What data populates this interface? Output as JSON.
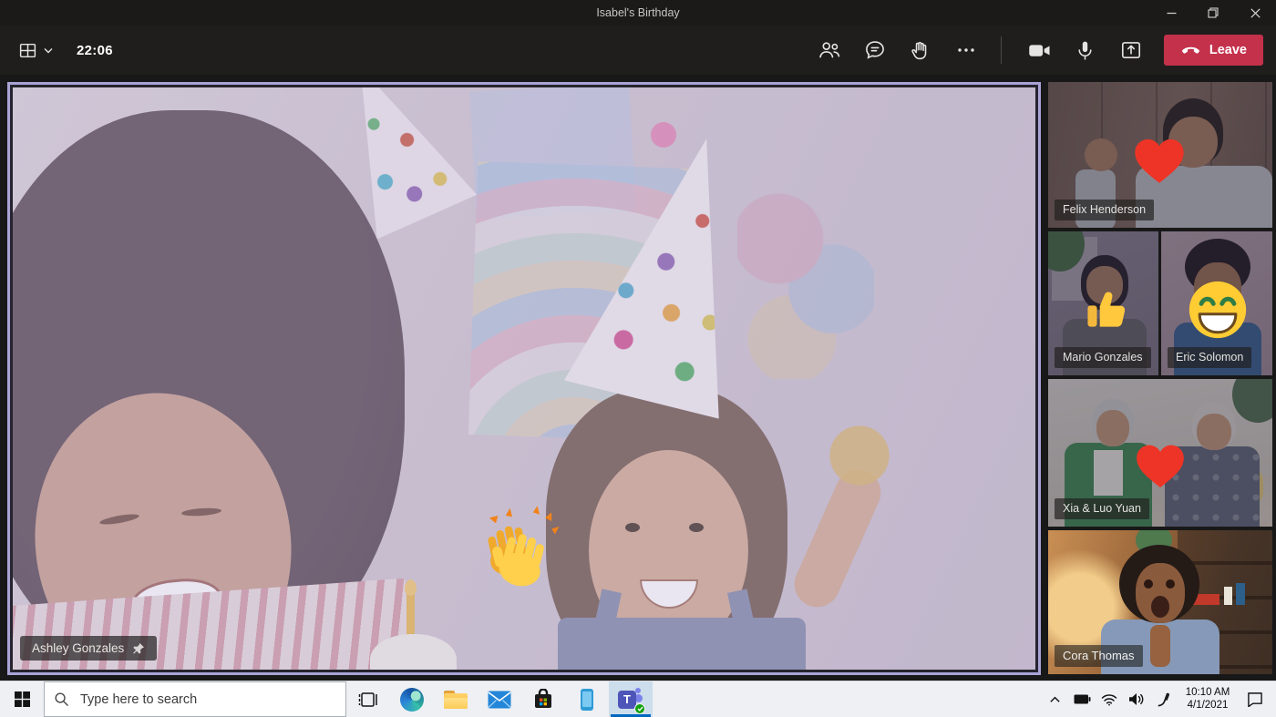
{
  "window": {
    "title": "Isabel's Birthday"
  },
  "meeting_toolbar": {
    "timer": "22:06",
    "leave_label": "Leave"
  },
  "stage": {
    "presenter_name": "Ashley Gonzales",
    "presenter_pinned": true,
    "presenter_reaction": "clapping-hands"
  },
  "participants": [
    {
      "name": "Felix Henderson",
      "reaction": "red-heart"
    },
    {
      "name": "Mario Gonzales",
      "reaction": "thumbs-up"
    },
    {
      "name": "Eric Solomon",
      "reaction": "beaming-face"
    },
    {
      "name": "Xia & Luo Yuan",
      "reaction": "red-heart"
    },
    {
      "name": "Cora Thomas",
      "reaction": ""
    }
  ],
  "taskbar": {
    "search_placeholder": "Type here to search",
    "clock_time": "10:10 AM",
    "clock_date": "4/1/2021"
  },
  "colors": {
    "leave_button": "#C4314B",
    "selection_border": "#A9A3D6",
    "taskbar_accent": "#0067C0",
    "reaction_red": "#EE3426",
    "reaction_gold": "#FFC83D"
  }
}
